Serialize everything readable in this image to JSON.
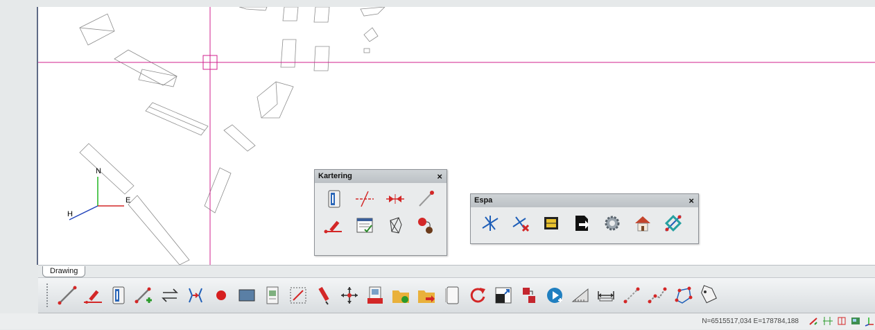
{
  "canvas": {
    "tab_label": "Drawing",
    "axis": {
      "north": "N",
      "east": "E",
      "height": "H"
    },
    "crosshair_color": "#d11f8e"
  },
  "kartering_panel": {
    "title": "Kartering",
    "close": "×",
    "tools": [
      "info-tool-icon",
      "break-line-icon",
      "join-points-icon",
      "point-line-icon",
      "edit-line-icon",
      "properties-form-icon",
      "polygon-fill-icon",
      "move-point-icon"
    ]
  },
  "espa_panel": {
    "title": "Espa",
    "close": "×",
    "tools": [
      "split-lines-icon",
      "delete-intersection-icon",
      "frame-icon",
      "export-icon",
      "settings-gear-icon",
      "house-icon",
      "satellite-link-icon"
    ]
  },
  "toolbar": {
    "tools": [
      "line-icon",
      "edit-line-icon",
      "info-panel-icon",
      "add-line-icon",
      "swap-direction-icon",
      "bracket-link-icon",
      "point-icon",
      "rectangle-icon",
      "raster-icon",
      "select-box-icon",
      "pen-icon",
      "move-icon",
      "wms-icon",
      "open-folder-icon",
      "import-folder-icon",
      "page-icon",
      "rotate-icon",
      "scale-icon",
      "step-icon",
      "play-add-icon",
      "area-measure-icon",
      "distance-measure-icon",
      "line-segment-icon",
      "polyline-icon",
      "polygon-icon",
      "tag-icon"
    ]
  },
  "statusbar": {
    "coordinates": "N=6515517,034 E=178784,188",
    "icons": [
      "snap-icon",
      "grid-icon",
      "ortho-icon",
      "map-icon",
      "axis-icon"
    ]
  },
  "colors": {
    "accent": "#d11f8e",
    "red": "#d32727",
    "blue": "#1f5fb8"
  }
}
